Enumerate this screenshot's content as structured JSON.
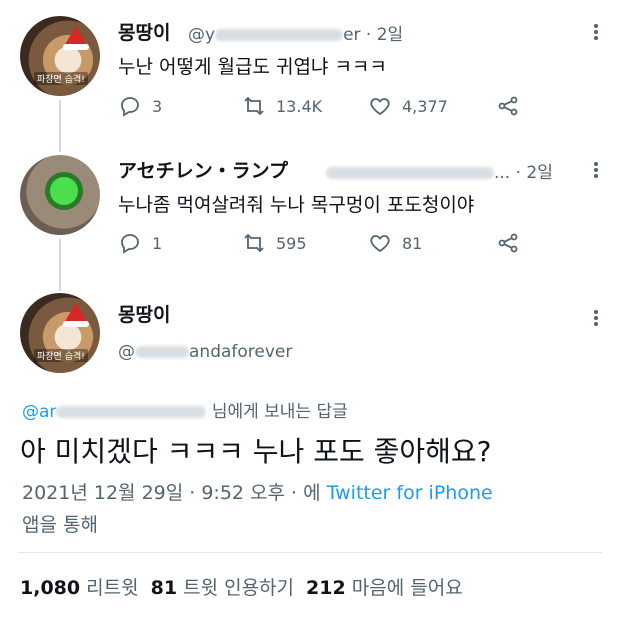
{
  "tweets": [
    {
      "name": "몽땅이",
      "handle_visible_start": "@y",
      "handle_visible_end": "er",
      "time": "· 2일",
      "text": "누난 어떻게 월급도 귀엽냐 ㅋㅋㅋ",
      "avatar_label": "파장면 습격!",
      "replies": "3",
      "retweets": "13.4K",
      "likes": "4,377"
    },
    {
      "name": "アセチレン・ランプ",
      "handle_visible_end": "...",
      "time": "· 2일",
      "text": "누나좀 먹여살려줘 누나 목구멍이 포도청이야",
      "replies": "1",
      "retweets": "595",
      "likes": "81"
    }
  ],
  "main": {
    "name": "몽땅이",
    "avatar_label": "파장면 습격!",
    "handle_visible_start": "@",
    "handle_visible_end": "andaforever",
    "reply_to_handle": "@ar",
    "reply_to_suffix": "님에게 보내는 답글",
    "text": "아 미치겠다 ㅋㅋㅋ 누나 포도 좋아해요?",
    "date": "2021년 12월 29일 · 9:52 오후 · 에",
    "source": "Twitter for iPhone",
    "via": "앱을 통해",
    "stats": {
      "retweets_count": "1,080",
      "retweets_label": "리트윗",
      "quotes_count": "81",
      "quotes_label": "트윗 인용하기",
      "likes_count": "212",
      "likes_label": "마음에 들어요"
    }
  }
}
